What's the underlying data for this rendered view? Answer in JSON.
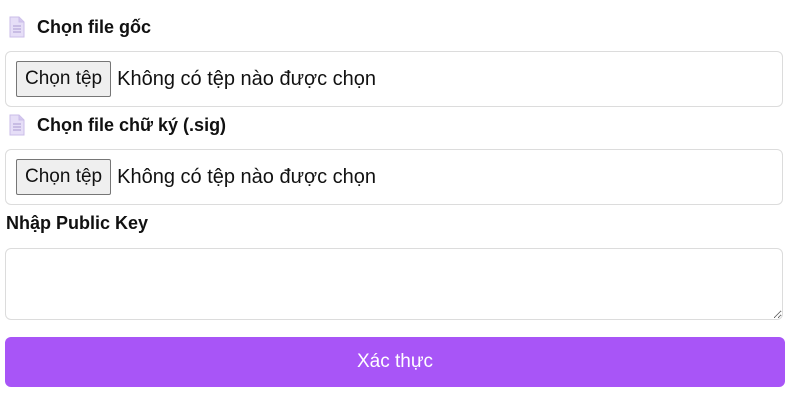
{
  "original_file": {
    "label": "Chọn file gốc",
    "button_label": "Chọn tệp",
    "status": "Không có tệp nào được chọn"
  },
  "signature_file": {
    "label": "Chọn file chữ ký (.sig)",
    "button_label": "Chọn tệp",
    "status": "Không có tệp nào được chọn"
  },
  "public_key": {
    "label": "Nhập Public Key",
    "value": ""
  },
  "submit": {
    "label": "Xác thực"
  },
  "icons": {
    "file_icon": "document-icon"
  },
  "colors": {
    "accent": "#a855f7",
    "icon": "#d9d0f2"
  }
}
